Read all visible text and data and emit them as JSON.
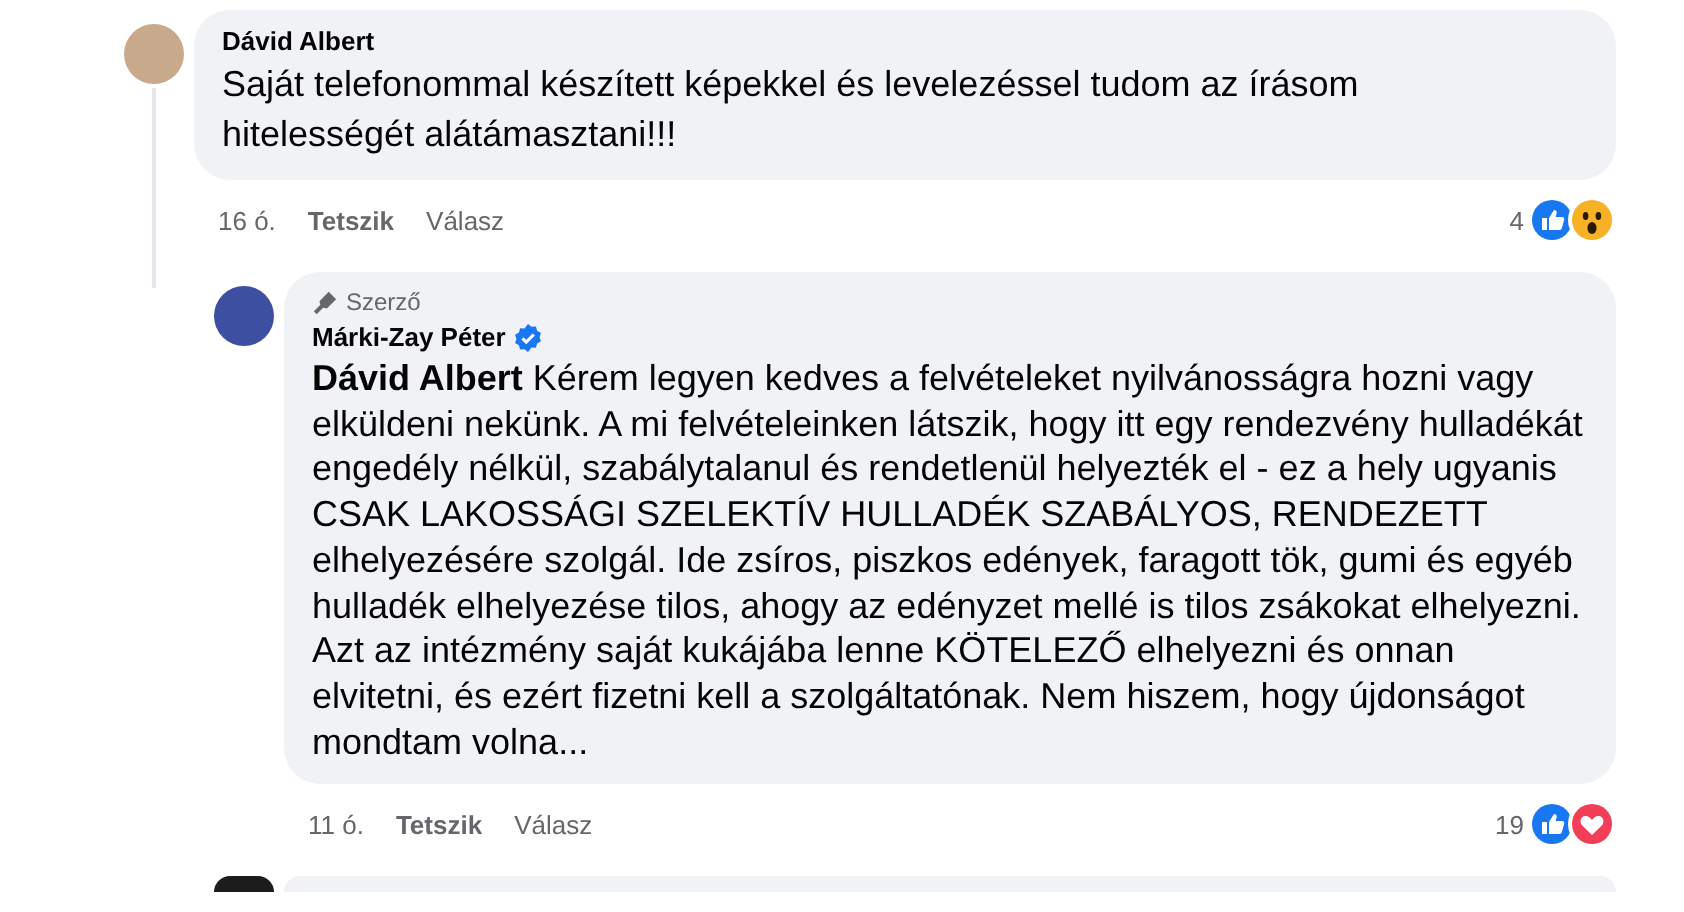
{
  "comments": [
    {
      "author": "Dávid Albert",
      "verified": false,
      "text": "Saját telefonommal készített képekkel és levelezéssel tudom az írásom hitelességét alátámasztani!!!",
      "time": "16 ó.",
      "like_label": "Tetszik",
      "reply_label": "Válasz",
      "reaction_count": "4",
      "reactions": [
        {
          "kind": "like"
        },
        {
          "kind": "wow"
        }
      ],
      "reply": false
    },
    {
      "author": "Márki-Zay Péter",
      "author_badge": "Szerző",
      "verified": true,
      "text": "**Dávid Albert** Kérem legyen kedves a felvételeket nyilvánosságra hozni vagy elküldeni nekünk. A mi felvételeinken látszik, hogy itt egy rendezvény hulladékát engedély nélkül, szabálytalanul és rendetlenül helyezték el - ez a hely ugyanis CSAK LAKOSSÁGI SZELEKTÍV HULLADÉK SZABÁLYOS, RENDEZETT elhelyezésére szolgál. Ide zsíros, piszkos edények, faragott tök, gumi és egyéb hulladék elhelyezése tilos, ahogy az edényzet mellé is tilos zsákokat elhelyezni. Azt az intézmény saját kukájába lenne KÖTELEZŐ elhelyezni és onnan elvitetni, és ezért fizetni kell a szolgáltatónak. Nem hiszem, hogy újdonságot mondtam volna...",
      "time": "11 ó.",
      "like_label": "Tetszik",
      "reply_label": "Válasz",
      "reaction_count": "19",
      "reactions": [
        {
          "kind": "like"
        },
        {
          "kind": "love"
        }
      ],
      "reply": true
    }
  ]
}
